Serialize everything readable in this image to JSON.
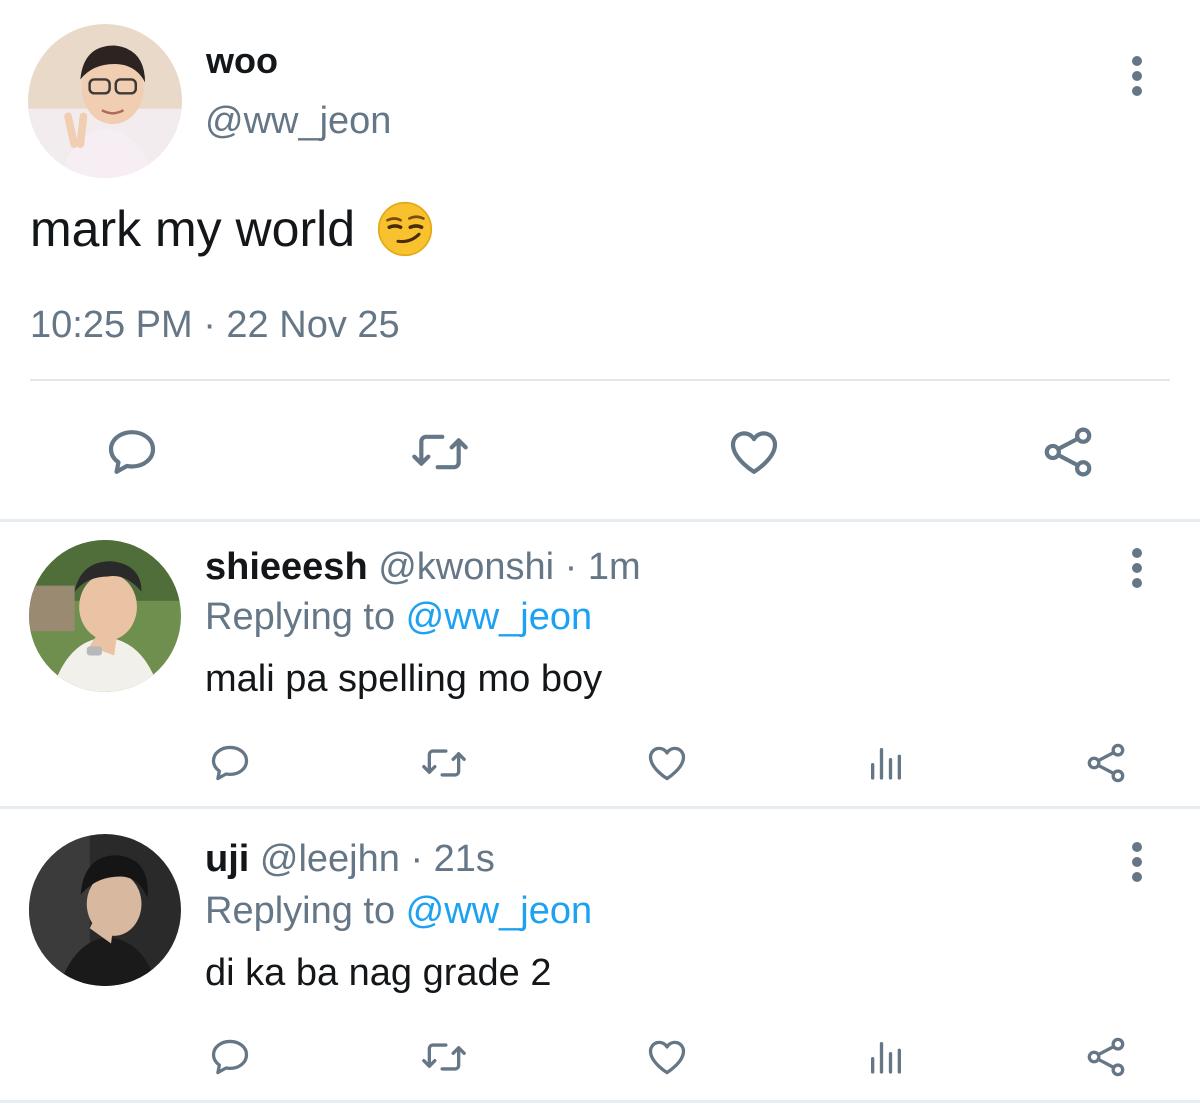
{
  "tweet": {
    "author_name": "woo",
    "author_handle": "@ww_jeon",
    "text": "mark my world",
    "emoji": "smirking-face-emoji",
    "timestamp": "10:25 PM · 22 Nov 25",
    "actions": [
      "reply-icon",
      "retweet-icon",
      "like-icon",
      "share-icon"
    ]
  },
  "replies": [
    {
      "author_name": "shieeesh",
      "author_handle": "@kwonshi",
      "age": "· 1m",
      "replying_prefix": "Replying to ",
      "replying_to": "@ww_jeon",
      "text": "mali pa spelling mo boy",
      "actions": [
        "reply-icon",
        "retweet-icon",
        "like-icon",
        "analytics-icon",
        "share-icon"
      ]
    },
    {
      "author_name": "uji",
      "author_handle": "@leejhn",
      "age": "· 21s",
      "replying_prefix": "Replying to ",
      "replying_to": "@ww_jeon",
      "text": "di ka ba nag grade 2",
      "actions": [
        "reply-icon",
        "retweet-icon",
        "like-icon",
        "analytics-icon",
        "share-icon"
      ]
    }
  ],
  "colors": {
    "primary_text": "#14171a",
    "secondary_text": "#657786",
    "link": "#1da1f2",
    "divider": "#e1e8ed"
  }
}
